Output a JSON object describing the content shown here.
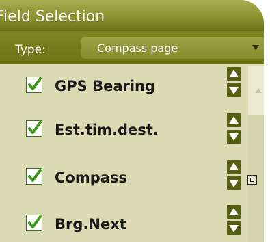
{
  "window": {
    "title": "Field Selection"
  },
  "type_selector": {
    "label": "Type:",
    "value": "Compass page"
  },
  "fields": [
    {
      "label": "GPS Bearing",
      "checked": true
    },
    {
      "label": "Est.tim.dest.",
      "checked": true
    },
    {
      "label": "Compass",
      "checked": true
    },
    {
      "label": "Brg.Next",
      "checked": true
    }
  ],
  "icons": {
    "checkbox": "check-mark-icon",
    "move_up": "triangle-up-icon",
    "move_down": "triangle-down-icon",
    "scroll_up": "scroll-up-icon",
    "mini": "target-square-icon"
  },
  "colors": {
    "title_bar": "#8c922f",
    "list_background": "#dbdbb3",
    "arrow_button": "#555f12",
    "check_green": "#3a9a1a"
  }
}
